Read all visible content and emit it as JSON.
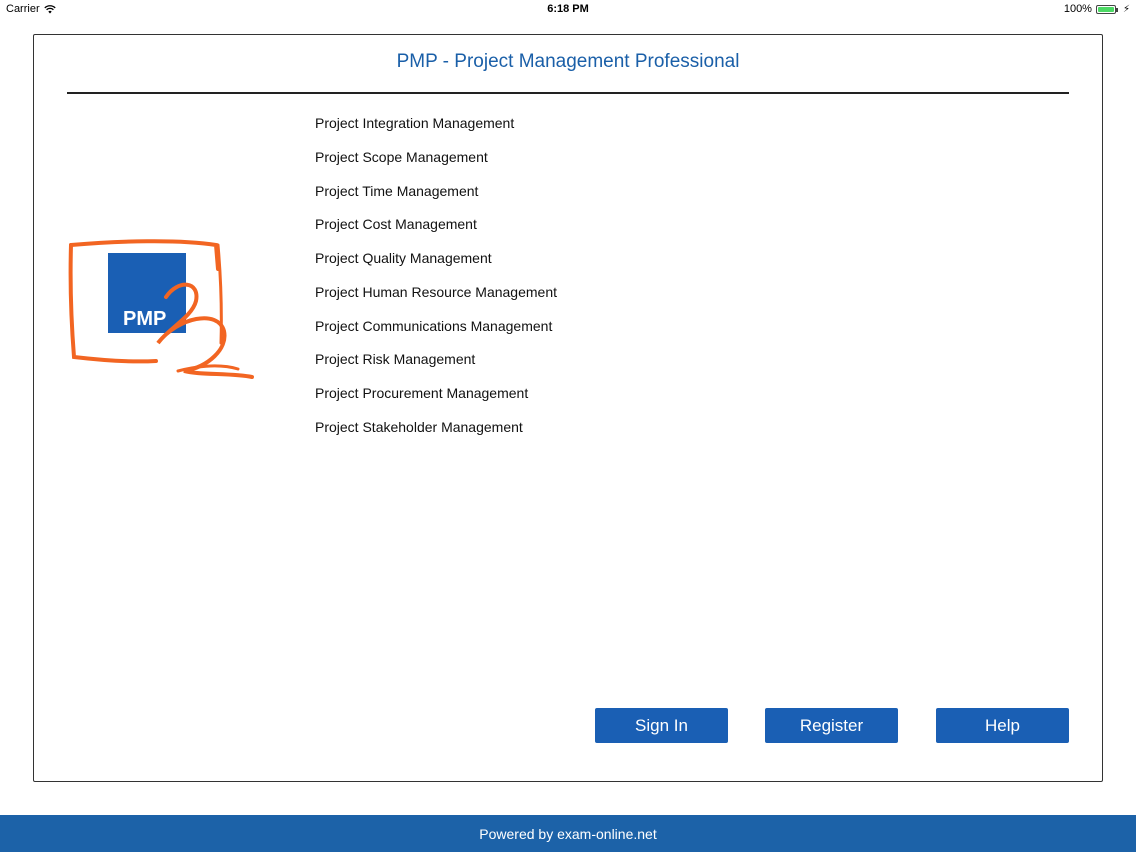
{
  "status_bar": {
    "carrier": "Carrier",
    "time": "6:18 PM",
    "battery": "100%"
  },
  "app": {
    "title": "PMP - Project Management Professional",
    "logo_text": "PMP"
  },
  "topics": [
    "Project Integration Management",
    "Project Scope Management",
    "Project Time Management",
    "Project Cost Management",
    "Project Quality Management",
    "Project Human Resource Management",
    "Project Communications Management",
    "Project Risk Management",
    "Project Procurement Management",
    "Project Stakeholder Management"
  ],
  "buttons": {
    "sign_in": "Sign In",
    "register": "Register",
    "help": "Help"
  },
  "footer": {
    "text": "Powered by exam-online.net"
  },
  "colors": {
    "accent": "#1a5fb4",
    "title": "#1a5fa8",
    "footer_bg": "#1c62a8",
    "logo_orange": "#f26522",
    "logo_blue": "#1a5fb4"
  },
  "icons": {
    "wifi": "wifi-icon",
    "battery": "battery-icon",
    "charging": "charging-icon"
  }
}
